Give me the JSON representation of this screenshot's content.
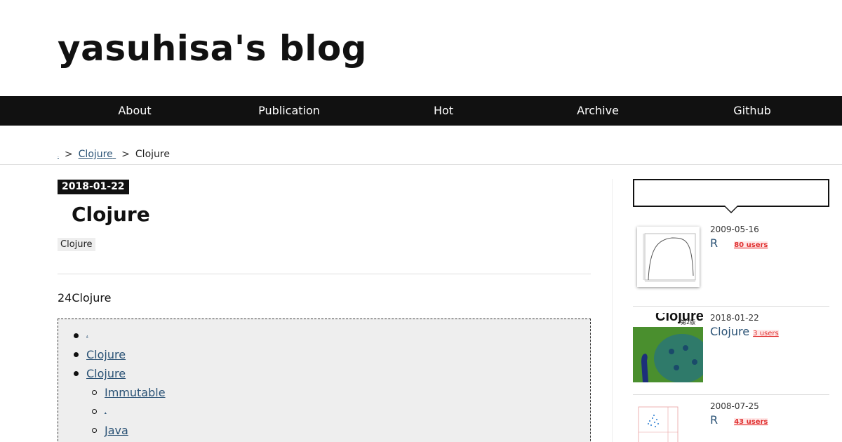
{
  "site": {
    "title": "yasuhisa's blog"
  },
  "nav": [
    {
      "label": "About"
    },
    {
      "label": "Publication"
    },
    {
      "label": "Hot"
    },
    {
      "label": "Archive"
    },
    {
      "label": "Github"
    }
  ],
  "breadcrumb": {
    "home": ".",
    "category": "Clojure",
    "current": "Clojure",
    "separator": ">"
  },
  "post": {
    "date": "2018-01-22",
    "title": "Clojure",
    "tag": "Clojure",
    "intro": "24Clojure",
    "toc": [
      {
        "label": ",",
        "level": 1
      },
      {
        "label": "Clojure",
        "level": 1
      },
      {
        "label": "Clojure",
        "level": 1
      },
      {
        "label": "Immutable",
        "level": 2
      },
      {
        "label": ",",
        "level": 2
      },
      {
        "label": "Java",
        "level": 2
      }
    ]
  },
  "sidebar": {
    "search": {
      "placeholder": ""
    },
    "hot": [
      {
        "date": "2009-05-16",
        "title": "R",
        "users": "80 users",
        "thumb": "plot-thumbnail"
      },
      {
        "date": "2018-01-22",
        "title": "Clojure",
        "users": "3 users",
        "thumb": "book-cover-thumbnail",
        "thumb_text": "Clojure",
        "thumb_sub": "第2版"
      },
      {
        "date": "2008-07-25",
        "title": "R",
        "users": "43 users",
        "thumb": "scatter-thumbnail"
      }
    ]
  },
  "colors": {
    "nav_bg": "#111111",
    "link": "#2a5275",
    "users": "#e03030"
  }
}
